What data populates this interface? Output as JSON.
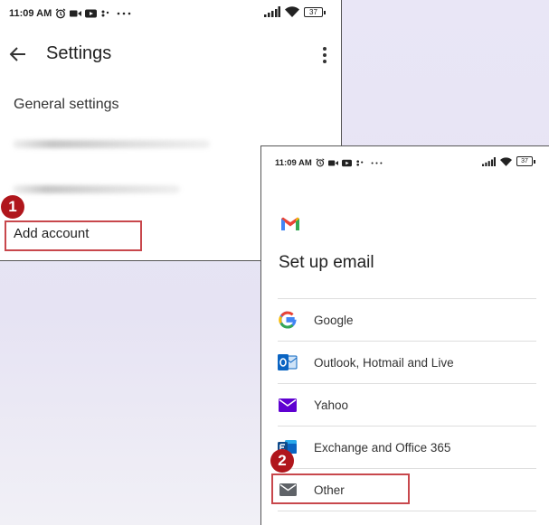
{
  "settings_screen": {
    "status_bar": {
      "time": "11:09 AM",
      "battery": "37"
    },
    "title": "Settings",
    "section_heading": "General settings",
    "add_account_label": "Add account",
    "step_marker": "1"
  },
  "setup_screen": {
    "status_bar": {
      "time": "11:09 AM",
      "battery": "37"
    },
    "title": "Set up email",
    "providers": [
      {
        "label": "Google",
        "icon": "google-icon"
      },
      {
        "label": "Outlook, Hotmail and Live",
        "icon": "outlook-icon"
      },
      {
        "label": "Yahoo",
        "icon": "yahoo-icon"
      },
      {
        "label": "Exchange and Office 365",
        "icon": "exchange-icon"
      },
      {
        "label": "Other",
        "icon": "mail-icon"
      }
    ],
    "step_marker": "2"
  },
  "colors": {
    "highlight_box": "#c8474c",
    "marker": "#b0161c",
    "background": "#e9e6f6"
  }
}
